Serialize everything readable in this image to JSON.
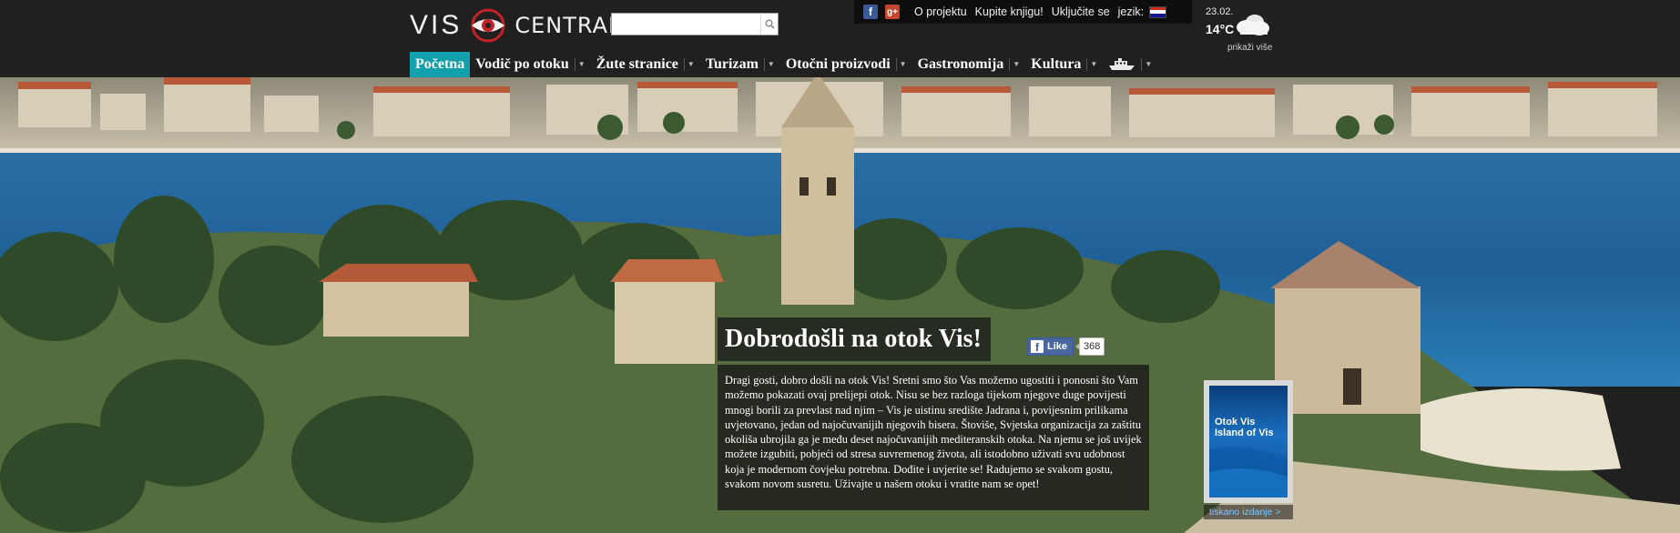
{
  "header": {
    "logo": {
      "left": "VIS",
      "right": "CENTRAL"
    },
    "search": {
      "value": "",
      "placeholder": ""
    },
    "topbar": {
      "links": [
        "O projektu",
        "Kupite knjigu!",
        "Uključite se"
      ],
      "language_label": "jezik:"
    },
    "weather": {
      "date": "23.02.",
      "temperature": "14°C",
      "more_label": "prikaži više"
    },
    "nav": [
      {
        "label": "Početna",
        "active": true,
        "dropdown": false
      },
      {
        "label": "Vodič po otoku",
        "dropdown": true
      },
      {
        "label": "Žute stranice",
        "dropdown": true
      },
      {
        "label": "Turizam",
        "dropdown": true
      },
      {
        "label": "Otočni proizvodi",
        "dropdown": true
      },
      {
        "label": "Gastronomija",
        "dropdown": true
      },
      {
        "label": "Kultura",
        "dropdown": true
      }
    ],
    "nav_last_icon": "ferry-icon"
  },
  "hero": {
    "title": "Dobrodošli na otok Vis!",
    "like": {
      "label": "Like",
      "count": "368"
    },
    "text": "Dragi gosti, dobro došli na otok Vis! Sretni smo što Vas možemo ugostiti i ponosni što Vam možemo pokazati ovaj prelijepi otok. Nisu se bez razloga tijekom njegove duge povijesti mnogi borili za prevlast nad njim – Vis je uistinu središte Jadrana i, povijesnim prilikama uvjetovano, jedan od najočuvanijih njegovih bisera. Štoviše, Svjetska organizacija za zaštitu okoliša ubrojila ga je među deset najočuvanijih mediteranskih otoka. Na njemu se još uvijek možete izgubiti, pobjeći od stresa suvremenog života, ali istodobno uživati svu udobnost koja je modernom čovjeku potrebna. Dođite i uvjerite se! Radujemo se svakom gostu, svakom novom susretu. Uživajte u našem otoku i vratite nam se opet!",
    "book": {
      "cover_title_1": "Otok Vis",
      "cover_title_2": "Island of Vis",
      "link_label": "tiskano izdanje >"
    }
  },
  "colors": {
    "header_bg": "#202020",
    "active_nav": "#13a0ad",
    "sea": "#1f5f96"
  }
}
